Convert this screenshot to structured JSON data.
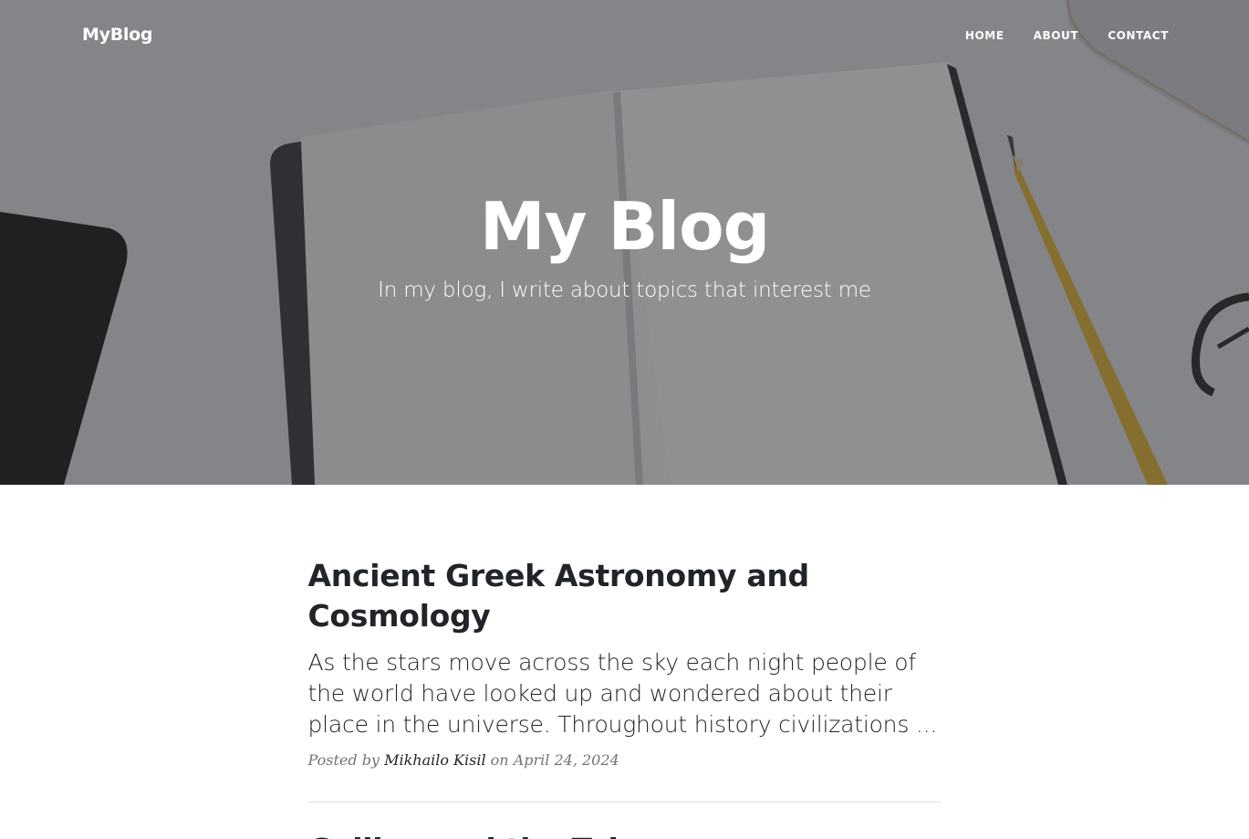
{
  "nav": {
    "brand": "MyBlog",
    "links": [
      "HOME",
      "ABOUT",
      "CONTACT"
    ]
  },
  "hero": {
    "title": "My Blog",
    "subtitle": "In my blog, I write about topics that interest me"
  },
  "posts": [
    {
      "title": "Ancient Greek Astronomy and Cosmology",
      "subtitle": "As the stars move across the sky each night people of the world have looked up and wondered about their place in the universe. Throughout history civilizations ...",
      "meta_prefix": "Posted by",
      "author": "Mikhailo Kisil",
      "meta_on": "on",
      "date": "April 24, 2024"
    },
    {
      "title": "Galileo and the Telescope"
    }
  ],
  "colors": {
    "text": "#212529",
    "muted": "#6c757d",
    "overlay": "#212529",
    "pencil": "#e8b634"
  },
  "icons": [
    "notebook-image",
    "pencil-image",
    "phone-image",
    "glasses-image"
  ]
}
